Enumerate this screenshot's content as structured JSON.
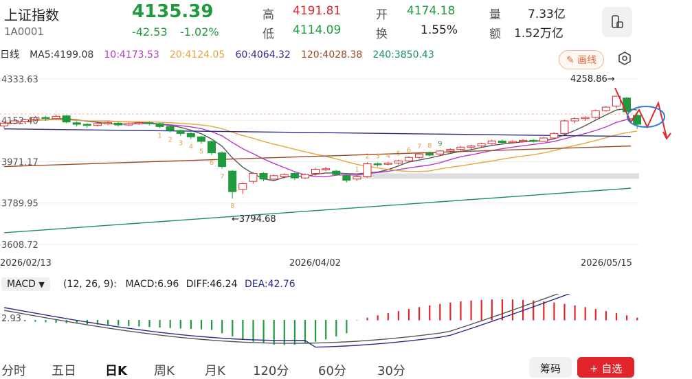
{
  "header": {
    "name": "上证指数",
    "code": "1A0001",
    "price": "4135.39",
    "change": "-42.53",
    "change_pct": "-1.02%",
    "high_label": "高",
    "high": "4191.81",
    "low_label": "低",
    "low": "4114.09",
    "open_label": "开",
    "open": "4174.18",
    "turnover_label": "换",
    "turnover": "1.55%",
    "volume_label": "量",
    "volume": "7.33亿",
    "amount_label": "额",
    "amount": "1.52万亿"
  },
  "ma_bar": {
    "period": "日线",
    "ma5": "MA5:4199.08",
    "ma10": "10:4173.53",
    "ma20": "20:4124.05",
    "ma60": "60:4064.32",
    "ma120": "120:4028.38",
    "ma240": "240:3850.43",
    "draw_button": "画线"
  },
  "colors": {
    "up": "#e0262b",
    "down": "#1f9a3c",
    "ma5": "#555555",
    "ma10": "#b43bc2",
    "ma20": "#e6a63a",
    "ma60": "#2b2b8a",
    "ma120": "#9b4a20",
    "ma240": "#1a8e66"
  },
  "chart_data": {
    "type": "candlestick",
    "y_ticks": [
      "4333.63",
      "4152.40",
      "3971.17",
      "3789.95",
      "3608.72"
    ],
    "ylim": [
      3608.72,
      4333.63
    ],
    "x_ticks": [
      "2026/02/13",
      "2026/04/02",
      "2026/05/15"
    ],
    "annotations": {
      "high": "4258.86",
      "low": "3794.68"
    },
    "candles": [
      [
        4128,
        4140,
        4118,
        4145
      ],
      [
        4140,
        4150,
        4135,
        4155
      ],
      [
        4148,
        4155,
        4140,
        4160
      ],
      [
        4155,
        4165,
        4150,
        4172
      ],
      [
        4165,
        4160,
        4150,
        4172
      ],
      [
        4160,
        4170,
        4155,
        4178
      ],
      [
        4172,
        4145,
        4140,
        4175
      ],
      [
        4142,
        4135,
        4125,
        4148
      ],
      [
        4135,
        4130,
        4120,
        4140
      ],
      [
        4130,
        4138,
        4125,
        4145
      ],
      [
        4138,
        4142,
        4132,
        4148
      ],
      [
        4140,
        4132,
        4125,
        4145
      ],
      [
        4132,
        4138,
        4128,
        4142
      ],
      [
        4138,
        4142,
        4132,
        4146
      ],
      [
        4142,
        4138,
        4130,
        4148
      ],
      [
        4138,
        4125,
        4118,
        4142
      ],
      [
        4125,
        4108,
        4100,
        4130
      ],
      [
        4108,
        4095,
        4085,
        4112
      ],
      [
        4095,
        4080,
        4070,
        4100
      ],
      [
        4080,
        4060,
        4050,
        4085
      ],
      [
        4060,
        4010,
        4000,
        4065
      ],
      [
        4010,
        3950,
        3940,
        4015
      ],
      [
        3930,
        3840,
        3810,
        3935
      ],
      [
        3850,
        3875,
        3830,
        3880
      ],
      [
        3885,
        3920,
        3875,
        3925
      ],
      [
        3920,
        3895,
        3885,
        3925
      ],
      [
        3895,
        3910,
        3890,
        3915
      ],
      [
        3905,
        3915,
        3898,
        3920
      ],
      [
        3920,
        3900,
        3890,
        3925
      ],
      [
        3900,
        3915,
        3895,
        3920
      ],
      [
        3920,
        3938,
        3910,
        3945
      ],
      [
        3938,
        3940,
        3930,
        3948
      ],
      [
        3930,
        3915,
        3910,
        3935
      ],
      [
        3910,
        3890,
        3880,
        3915
      ],
      [
        3895,
        3905,
        3888,
        3910
      ],
      [
        3905,
        3962,
        3900,
        3968
      ],
      [
        3962,
        3958,
        3950,
        3968
      ],
      [
        3960,
        3965,
        3955,
        3970
      ],
      [
        3965,
        3975,
        3958,
        3980
      ],
      [
        3975,
        3990,
        3970,
        3995
      ],
      [
        3990,
        4005,
        3985,
        4010
      ],
      [
        4008,
        4000,
        3995,
        4015
      ],
      [
        4005,
        4018,
        4000,
        4022
      ],
      [
        4018,
        4025,
        4010,
        4030
      ],
      [
        4025,
        4035,
        4020,
        4040
      ],
      [
        4035,
        4040,
        4025,
        4045
      ],
      [
        4040,
        4050,
        4035,
        4055
      ],
      [
        4050,
        4062,
        4045,
        4068
      ],
      [
        4062,
        4055,
        4050,
        4068
      ],
      [
        4055,
        4060,
        4050,
        4065
      ],
      [
        4060,
        4065,
        4055,
        4070
      ],
      [
        4065,
        4060,
        4055,
        4070
      ],
      [
        4060,
        4075,
        4058,
        4080
      ],
      [
        4075,
        4095,
        4070,
        4100
      ],
      [
        4095,
        4150,
        4090,
        4155
      ],
      [
        4150,
        4160,
        4140,
        4165
      ],
      [
        4160,
        4165,
        4150,
        4170
      ],
      [
        4165,
        4195,
        4160,
        4200
      ],
      [
        4195,
        4210,
        4190,
        4215
      ],
      [
        4215,
        4258,
        4205,
        4258
      ],
      [
        4250,
        4190,
        4180,
        4255
      ],
      [
        4174,
        4135,
        4114,
        4191
      ]
    ],
    "nine_marks_down": [
      "1",
      "2",
      "3",
      "4",
      "5",
      "6",
      "7",
      "8",
      "9"
    ],
    "nine_marks_up": [
      "1",
      "2",
      "3",
      "4",
      "5",
      "6",
      "7",
      "8",
      "9"
    ]
  },
  "macd": {
    "selector": "MACD",
    "params": "(12, 26, 9):",
    "macd": "MACD:6.96",
    "diff": "DIFF:46.24",
    "dea": "DEA:42.76",
    "axis_label": "2.93"
  },
  "tabs": [
    "分时",
    "五日",
    "日K",
    "周K",
    "月K",
    "120分",
    "60分",
    "30分"
  ],
  "active_tab": "日K",
  "bottom": {
    "chips": "筹码",
    "add_watch": "+ 自选"
  }
}
